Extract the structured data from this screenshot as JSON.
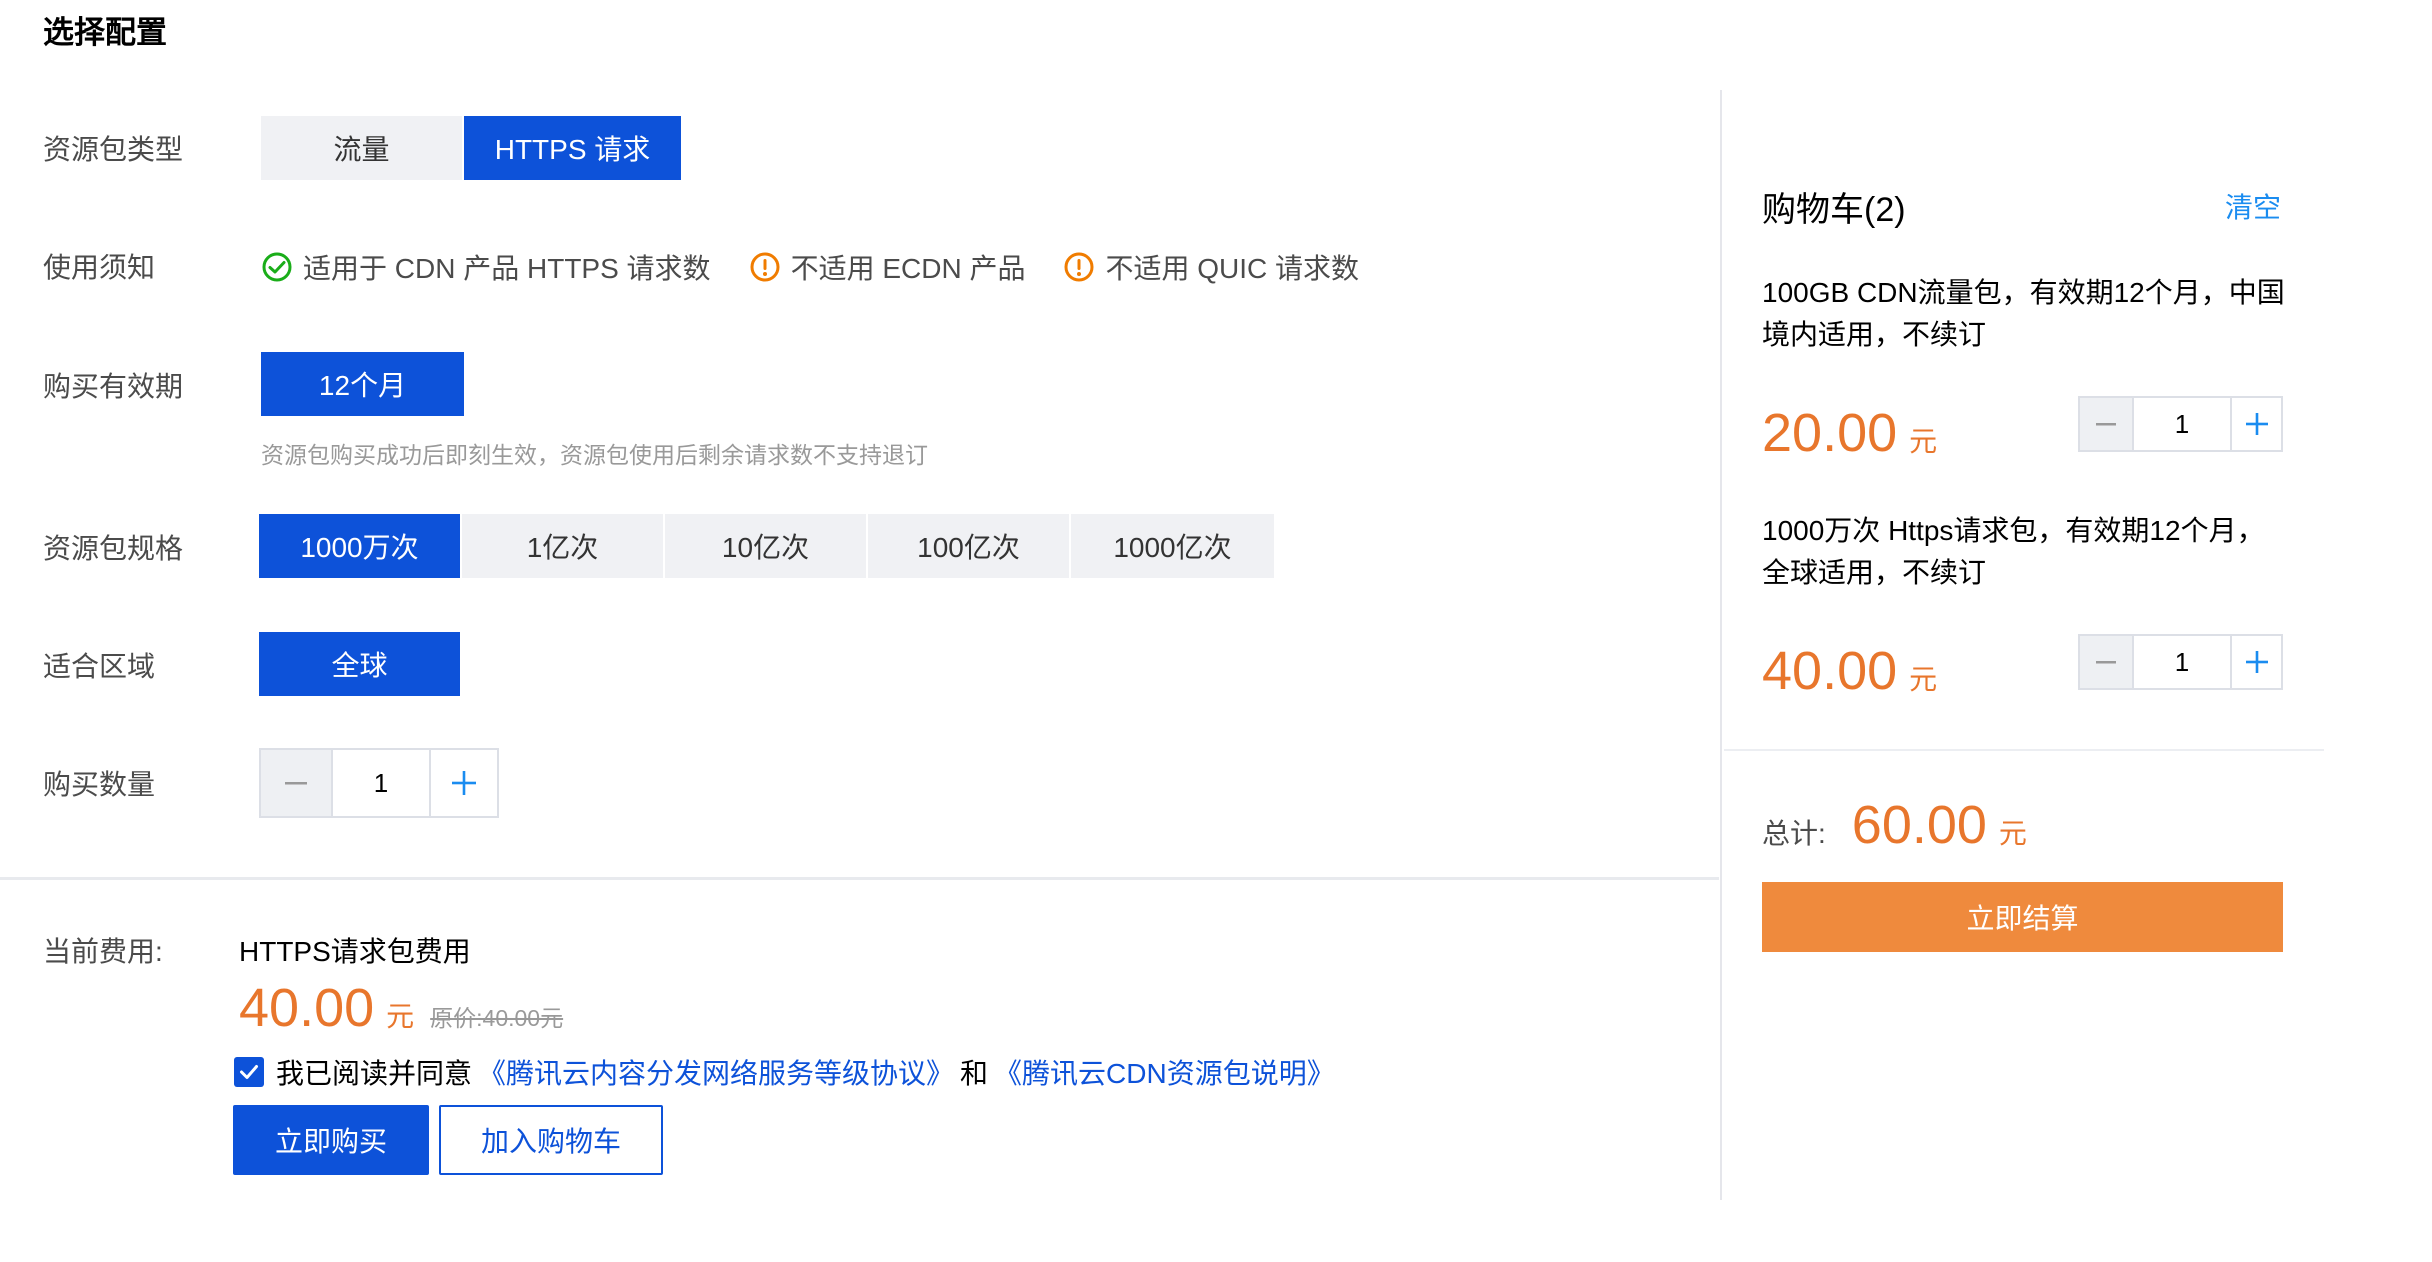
{
  "page_title": "选择配置",
  "colors": {
    "primary": "#0d52d9",
    "price": "#e8762c",
    "success": "#1aad19",
    "warning": "#f07c00",
    "checkout": "#ef8a3d",
    "link_light": "#1a8cf0"
  },
  "config": {
    "package_type": {
      "label": "资源包类型",
      "options": [
        "流量",
        "HTTPS 请求"
      ],
      "selected": 1
    },
    "notice": {
      "label": "使用须知",
      "items": [
        {
          "icon": "check-circle-icon",
          "text": "适用于 CDN 产品 HTTPS 请求数"
        },
        {
          "icon": "warning-circle-icon",
          "text": "不适用 ECDN 产品"
        },
        {
          "icon": "warning-circle-icon",
          "text": "不适用 QUIC 请求数"
        }
      ]
    },
    "validity": {
      "label": "购买有效期",
      "options": [
        "12个月"
      ],
      "selected": 0,
      "hint": "资源包购买成功后即刻生效，资源包使用后剩余请求数不支持退订"
    },
    "spec": {
      "label": "资源包规格",
      "options": [
        "1000万次",
        "1亿次",
        "10亿次",
        "100亿次",
        "1000亿次"
      ],
      "selected": 0
    },
    "region": {
      "label": "适合区域",
      "options": [
        "全球"
      ],
      "selected": 0
    },
    "quantity": {
      "label": "购买数量",
      "value": "1"
    }
  },
  "fee": {
    "label": "当前费用:",
    "item_name": "HTTPS请求包费用",
    "price": "40.00",
    "unit": "元",
    "original": "原价:40.00元",
    "agree_text": "我已阅读并同意",
    "link1": "《腾讯云内容分发网络服务等级协议》",
    "and": "和",
    "link2": "《腾讯云CDN资源包说明》",
    "buy_button": "立即购买",
    "cart_button": "加入购物车"
  },
  "cart": {
    "title": "购物车(2)",
    "clear": "清空",
    "items": [
      {
        "desc": "100GB CDN流量包，有效期12个月，中国境内适用，不续订",
        "price": "20.00",
        "unit": "元",
        "qty": "1"
      },
      {
        "desc": "1000万次 Https请求包，有效期12个月，全球适用，不续订",
        "price": "40.00",
        "unit": "元",
        "qty": "1"
      }
    ],
    "total_label": "总计:",
    "total": "60.00",
    "total_unit": "元",
    "checkout": "立即结算"
  }
}
